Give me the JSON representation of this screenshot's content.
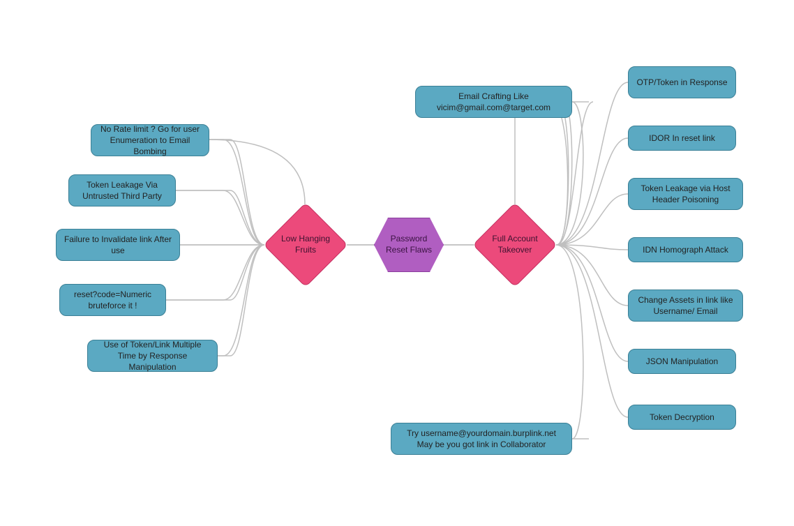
{
  "center": {
    "label": "Password Reset Flaws"
  },
  "diamonds": {
    "left": "Low Hanging Fruits",
    "right": "Full Account Takeover"
  },
  "left_nodes": [
    "No Rate limit ? Go for user Enumeration to Email Bombing",
    "Token Leakage Via Untrusted Third Party",
    "Failure to Invalidate link After use",
    "reset?code=Numeric bruteforce it !",
    "Use of Token/Link Multiple Time by Response Manipulation"
  ],
  "right_nodes_inner": [
    "Email Crafting Like vicim@gmail.com@target.com",
    "Try username@yourdomain.burplink.net May be you got link in Collaborator"
  ],
  "right_nodes_outer": [
    "OTP/Token in Response",
    "IDOR In reset link",
    "Token Leakage via Host Header Poisoning",
    "IDN Homograph Attack",
    "Change Assets in link like Username/ Email",
    "JSON Manipulation",
    "Token Decryption"
  ]
}
